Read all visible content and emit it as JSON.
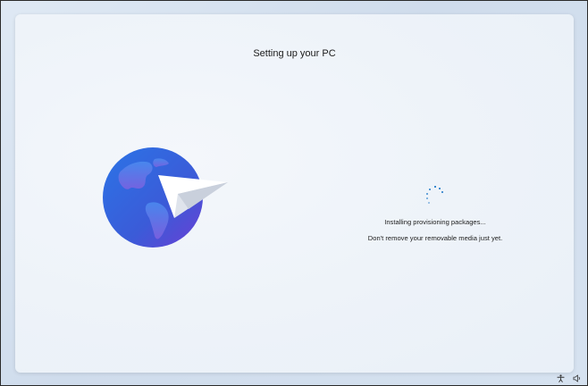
{
  "window": {
    "title": "Setting up your PC"
  },
  "status": {
    "line1": "Installing provisioning packages...",
    "line2": "Don't remove your removable media just yet."
  },
  "icons": {
    "hero": "globe-paper-plane-icon",
    "spinner": "loading-spinner-icon",
    "tray": [
      "accessibility-icon",
      "volume-icon"
    ]
  },
  "colors": {
    "accent": "#0067c0",
    "globe_top": "#2b6fe0",
    "globe_bottom": "#6b3fd6",
    "background": "#e9f0f8"
  }
}
